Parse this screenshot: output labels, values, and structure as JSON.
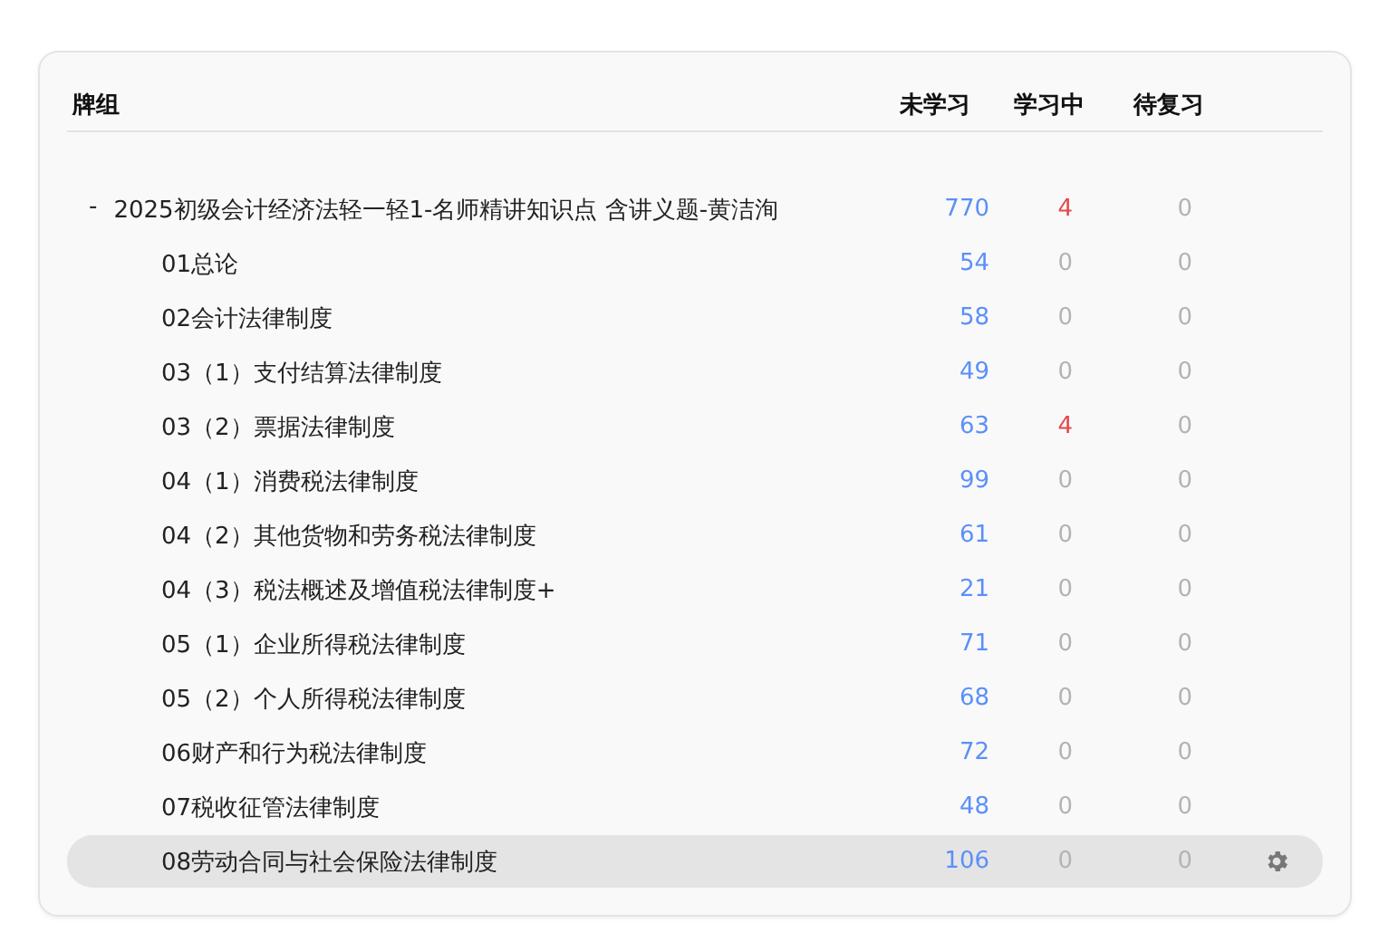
{
  "table": {
    "columns": [
      "牌组",
      "未学习",
      "学习中",
      "待复习"
    ],
    "rows": [
      {
        "toggle": "-",
        "name": "2025初级会计经济法轻一轻1-名师精讲知识点 含讲义题-黄洁洵",
        "new": "770",
        "learning": "4",
        "review": "0",
        "selected": false,
        "children": [
          {
            "name": "01总论",
            "new": "54",
            "learning": "0",
            "review": "0",
            "selected": false
          },
          {
            "name": "02会计法律制度",
            "new": "58",
            "learning": "0",
            "review": "0",
            "selected": false
          },
          {
            "name": "03（1）支付结算法律制度",
            "new": "49",
            "learning": "0",
            "review": "0",
            "selected": false
          },
          {
            "name": "03（2）票据法律制度",
            "new": "63",
            "learning": "4",
            "review": "0",
            "selected": false
          },
          {
            "name": "04（1）消费税法律制度",
            "new": "99",
            "learning": "0",
            "review": "0",
            "selected": false
          },
          {
            "name": "04（2）其他货物和劳务税法律制度",
            "new": "61",
            "learning": "0",
            "review": "0",
            "selected": false
          },
          {
            "name": "04（3）税法概述及增值税法律制度+",
            "new": "21",
            "learning": "0",
            "review": "0",
            "selected": false
          },
          {
            "name": "05（1）企业所得税法律制度",
            "new": "71",
            "learning": "0",
            "review": "0",
            "selected": false
          },
          {
            "name": "05（2）个人所得税法律制度",
            "new": "68",
            "learning": "0",
            "review": "0",
            "selected": false
          },
          {
            "name": "06财产和行为税法律制度",
            "new": "72",
            "learning": "0",
            "review": "0",
            "selected": false
          },
          {
            "name": "07税收征管法律制度",
            "new": "48",
            "learning": "0",
            "review": "0",
            "selected": false
          },
          {
            "name": "08劳动合同与社会保险法律制度",
            "new": "106",
            "learning": "0",
            "review": "0",
            "selected": true
          }
        ]
      }
    ]
  }
}
